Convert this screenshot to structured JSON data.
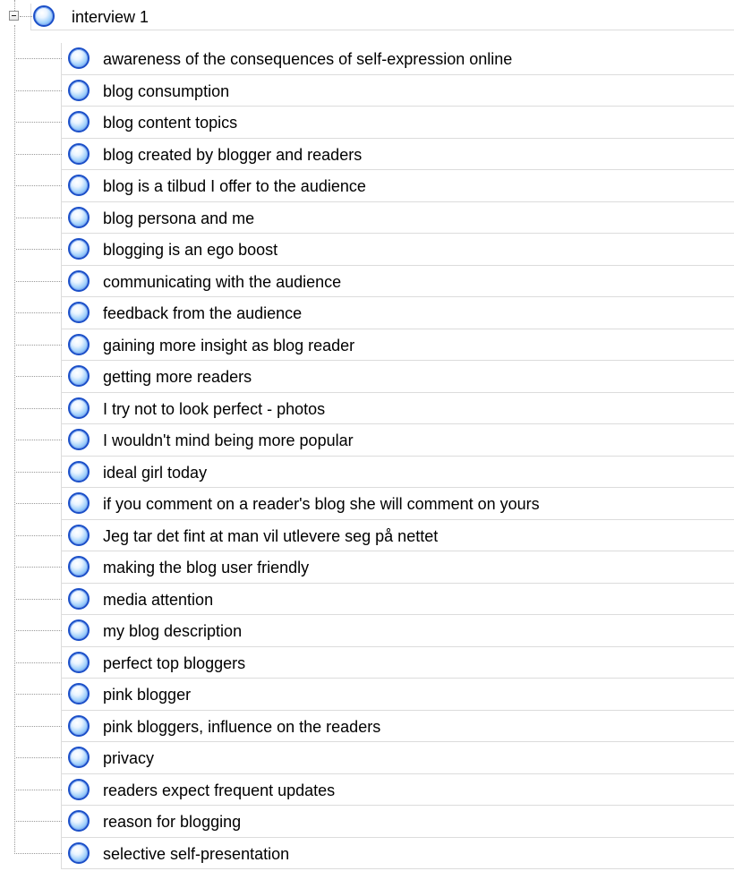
{
  "tree": {
    "root": {
      "label": "interview 1",
      "icon": "node-circle-icon",
      "expanded": true
    },
    "children": [
      "awareness of the consequences of self-expression online",
      "blog consumption",
      "blog content topics",
      "blog created by blogger and readers",
      "blog is a tilbud I offer to the audience",
      "blog persona and me",
      "blogging is an ego boost",
      "communicating with the audience",
      "feedback from the audience",
      "gaining more insight as blog reader",
      "getting more readers",
      "I try not to look perfect - photos",
      "I wouldn't mind being more popular",
      "ideal girl today",
      "if you comment on a reader's blog she will comment on yours",
      "Jeg tar det fint at man vil utlevere seg på nettet",
      "making the blog user friendly",
      "media attention",
      "my blog description",
      "perfect top bloggers",
      "pink blogger",
      "pink bloggers, influence on the readers",
      "privacy",
      "readers expect frequent updates",
      "reason for blogging",
      "selective self-presentation"
    ]
  },
  "colors": {
    "icon_border": "#1b4fc8",
    "icon_fill": "#9fd0fb",
    "grid_line": "#dcdcdc",
    "guide_line": "#9a9a9a"
  }
}
